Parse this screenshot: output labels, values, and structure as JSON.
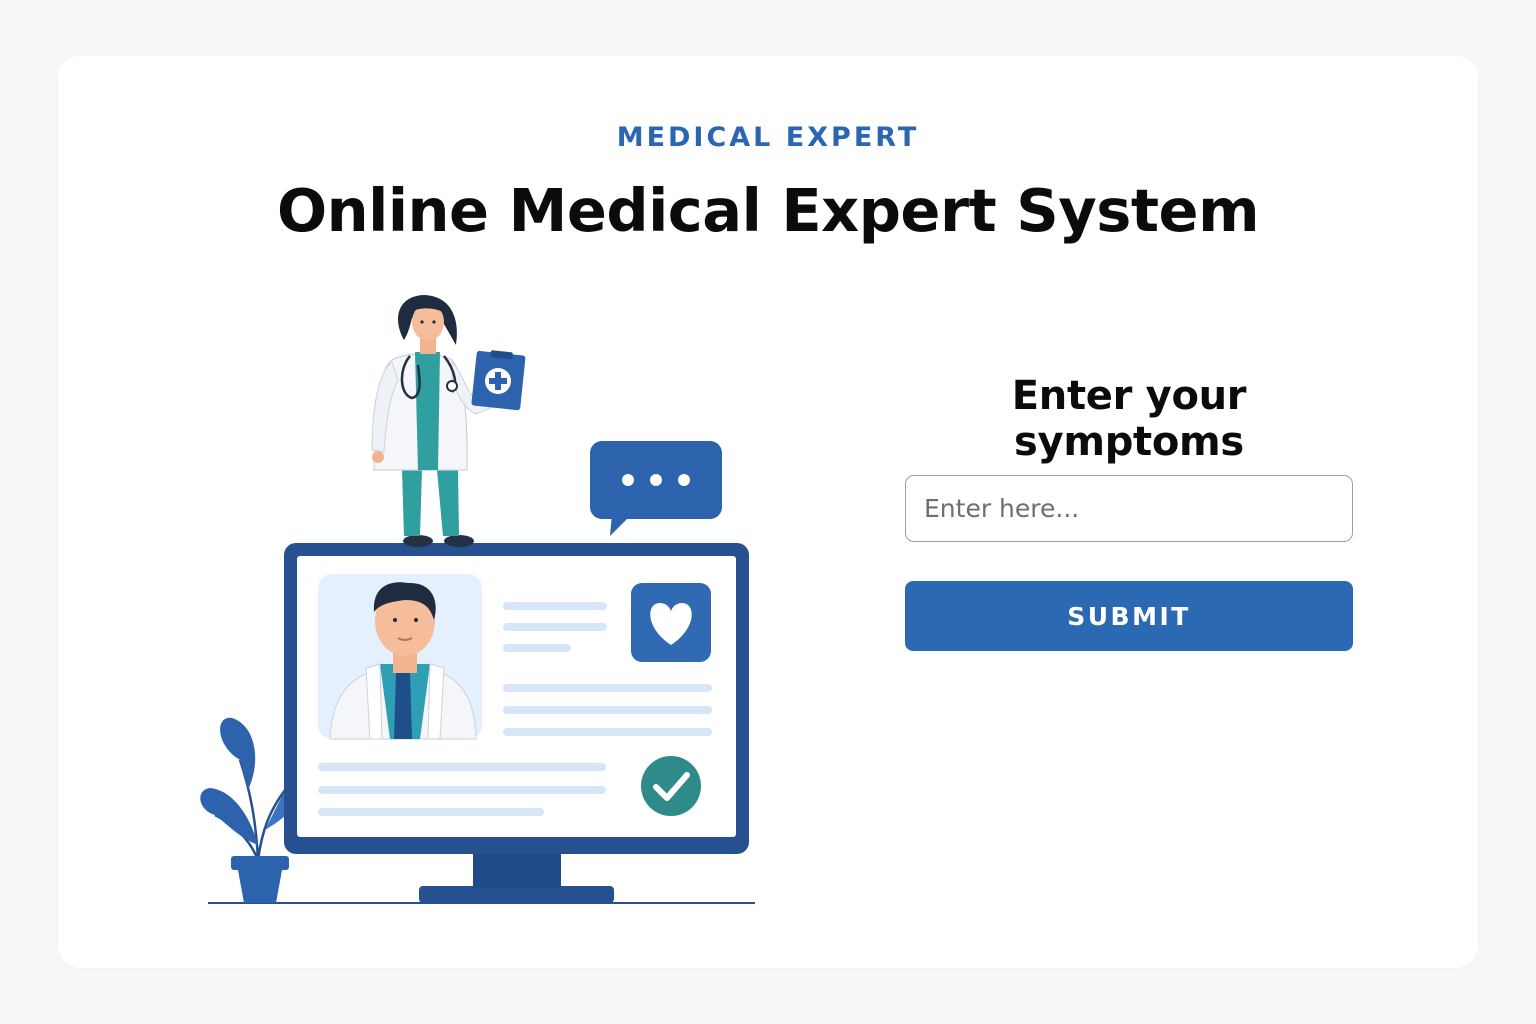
{
  "header": {
    "eyebrow": "MEDICAL EXPERT",
    "title": "Online Medical Expert System"
  },
  "form": {
    "heading": "Enter your symptoms",
    "input_placeholder": "Enter here...",
    "input_value": "",
    "submit_label": "SUBMIT"
  },
  "illustration": {
    "icons": [
      "female-doctor-icon",
      "clipboard-plus-icon",
      "chat-bubble-icon",
      "computer-monitor-icon",
      "male-doctor-icon",
      "heart-icon",
      "check-circle-icon",
      "plant-icon"
    ]
  },
  "colors": {
    "accent": "#2b6ab3",
    "eyebrow": "#2b66b1",
    "title": "#0b0b0c",
    "monitor_frame": "#26508f",
    "teal": "#2f8a8a",
    "light_blue": "#dbe8f8"
  }
}
